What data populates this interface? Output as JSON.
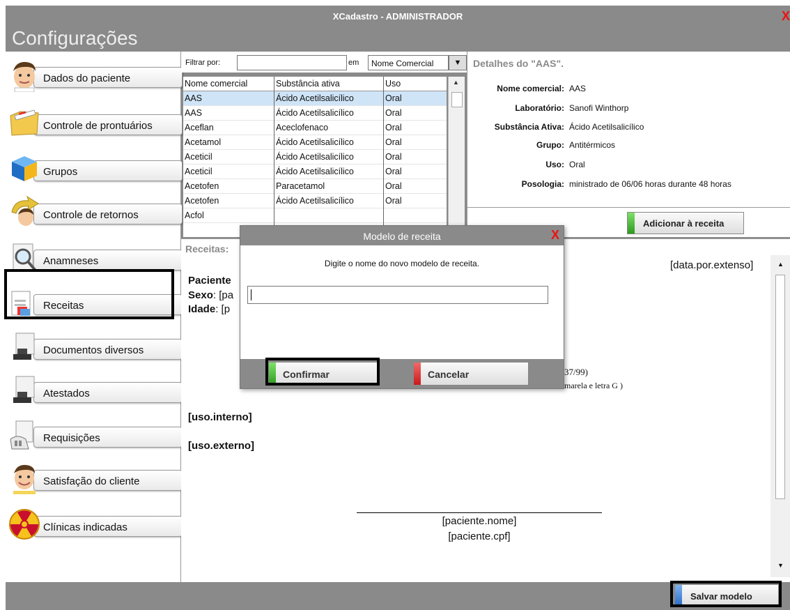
{
  "window": {
    "title": "XCadastro - ADMINISTRADOR",
    "close_symbol": "X"
  },
  "header": {
    "title": "Configurações"
  },
  "sidebar": {
    "items": [
      {
        "label": "Dados do paciente",
        "icon": "doctor-face-icon"
      },
      {
        "label": "Controle de prontuários",
        "icon": "folder-icon"
      },
      {
        "label": "Grupos",
        "icon": "cube-icon"
      },
      {
        "label": "Controle de retornos",
        "icon": "return-arrow-icon"
      },
      {
        "label": "Anamneses",
        "icon": "magnifier-icon"
      },
      {
        "label": "Receitas",
        "icon": "prescription-icon"
      },
      {
        "label": "Documentos diversos",
        "icon": "stamp-document-icon"
      },
      {
        "label": "Atestados",
        "icon": "stamp-certificate-icon"
      },
      {
        "label": "Requisições",
        "icon": "requisition-icon"
      },
      {
        "label": "Satisfação do cliente",
        "icon": "happy-doctor-icon"
      },
      {
        "label": "Clínicas indicadas",
        "icon": "radiation-icon"
      }
    ]
  },
  "filter": {
    "label": "Filtrar por:",
    "value": "",
    "em_label": "em",
    "selected": "Nome Comercial",
    "arrow": "▼"
  },
  "table": {
    "headers": [
      "Nome comercial",
      "Substância ativa",
      "Uso"
    ],
    "rows": [
      [
        "AAS",
        "Ácido Acetilsalicílico",
        "Oral"
      ],
      [
        "AAS",
        "Ácido Acetilsalicílico",
        "Oral"
      ],
      [
        "Aceflan",
        "Aceclofenaco",
        "Oral"
      ],
      [
        "Acetamol",
        "Ácido Acetilsalicílico",
        "Oral"
      ],
      [
        "Aceticil",
        "Ácido Acetilsalicílico",
        "Oral"
      ],
      [
        "Aceticil",
        "Ácido Acetilsalicílico",
        "Oral"
      ],
      [
        "Acetofen",
        "Paracetamol",
        "Oral"
      ],
      [
        "Acetofen",
        "Ácido Acetilsalicílico",
        "Oral"
      ],
      [
        "Acfol",
        "",
        ""
      ]
    ],
    "selected_row": 0
  },
  "details": {
    "title": "Detalhes do \"AAS\".",
    "fields": [
      {
        "key": "Nome comercial:",
        "value": "AAS"
      },
      {
        "key": "Laboratório:",
        "value": "Sanofi Winthorp"
      },
      {
        "key": "Substância Ativa:",
        "value": "Ácido Acetilsalicílico"
      },
      {
        "key": "Grupo:",
        "value": "Antitérmicos"
      },
      {
        "key": "Uso:",
        "value": "Oral"
      },
      {
        "key": "Posologia:",
        "value": "ministrado de 06/06 horas durante 48 horas"
      }
    ],
    "add_button": "Adicionar à receita"
  },
  "editor": {
    "label": "Receitas:",
    "date": "[data.por.extenso]",
    "paciente": "Paciente",
    "sexo_key": "Sexo",
    "sexo_val": ": [pa",
    "idade_key": "Idade",
    "idade_val": ": [p",
    "partial1": "37/99)",
    "partial2": "marela e letra G )",
    "uso_interno": "[uso.interno]",
    "uso_externo": "[uso.externo]",
    "sig_name": "[paciente.nome]",
    "sig_cpf": "[paciente.cpf]"
  },
  "footer": {
    "save_button": "Salvar modelo"
  },
  "modal": {
    "title": "Modelo de receita",
    "close_symbol": "X",
    "message": "Digite o nome do novo modelo de receita.",
    "input_value": "",
    "confirm": "Confirmar",
    "cancel": "Cancelar"
  },
  "colors": {
    "titlebar": "#8a8a8a",
    "selection": "#cfe4f7",
    "confirm_stripe": "#2d9a1e",
    "cancel_stripe": "#c81a1a",
    "save_stripe": "#2a6bc8",
    "highlight": "#000000"
  }
}
